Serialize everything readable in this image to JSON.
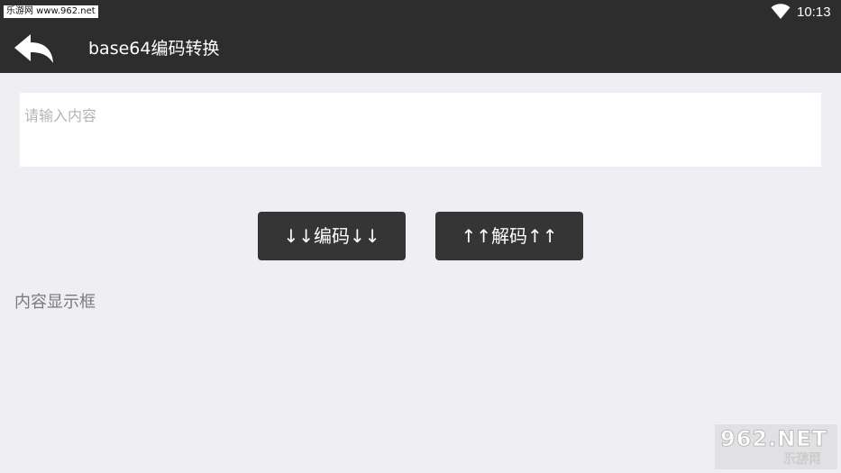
{
  "watermark": {
    "top_text": "乐游网 www.962.net",
    "logo_main": "962.NET",
    "logo_sub": "乐游网"
  },
  "status_bar": {
    "time": "10:13",
    "wifi_icon": "wifi-icon"
  },
  "app_bar": {
    "back_icon": "back-arrow-icon",
    "title": "base64编码转换"
  },
  "input": {
    "placeholder": "请输入内容",
    "value": ""
  },
  "buttons": {
    "encode_label": "↓↓编码↓↓",
    "decode_label": "↑↑解码↑↑"
  },
  "output": {
    "label": "内容显示框"
  },
  "colors": {
    "bar_background": "#2d2d2d",
    "page_background": "#efeef3",
    "button_background": "#353535"
  }
}
